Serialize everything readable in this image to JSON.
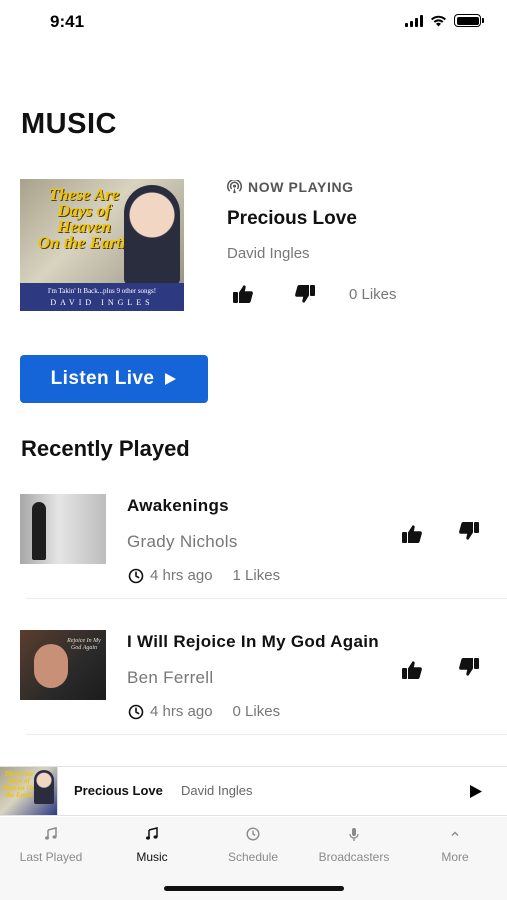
{
  "status_bar": {
    "time": "9:41"
  },
  "page": {
    "title": "MUSIC"
  },
  "now_playing": {
    "label": "NOW PLAYING",
    "title": "Precious Love",
    "artist": "David Ingles",
    "likes": "0 Likes",
    "album_art": {
      "title_lines": [
        "These Are",
        "Days of",
        "Heaven",
        "On the Earth"
      ],
      "subtitle": "I'm Takin' It Back...plus 9 other songs!",
      "artist": "DAVID INGLES"
    }
  },
  "listen_live": {
    "label": "Listen Live"
  },
  "recently_played": {
    "title": "Recently Played",
    "items": [
      {
        "title": "Awakenings",
        "artist": "Grady Nichols",
        "time": "4 hrs ago",
        "likes": "1 Likes"
      },
      {
        "title": "I Will Rejoice In My God Again",
        "artist": "Ben Ferrell",
        "time": "4 hrs ago",
        "likes": "0 Likes"
      }
    ]
  },
  "mini_player": {
    "title": "Precious Love",
    "artist": "David Ingles"
  },
  "tabs": [
    {
      "label": "Last Played",
      "icon": "music-note-icon",
      "active": false
    },
    {
      "label": "Music",
      "icon": "music-note-icon",
      "active": true
    },
    {
      "label": "Schedule",
      "icon": "clock-icon",
      "active": false
    },
    {
      "label": "Broadcasters",
      "icon": "microphone-icon",
      "active": false
    },
    {
      "label": "More",
      "icon": "chevron-up-icon",
      "active": false
    }
  ],
  "colors": {
    "accent": "#1565d8",
    "text_primary": "#111111",
    "text_secondary": "#777777"
  }
}
